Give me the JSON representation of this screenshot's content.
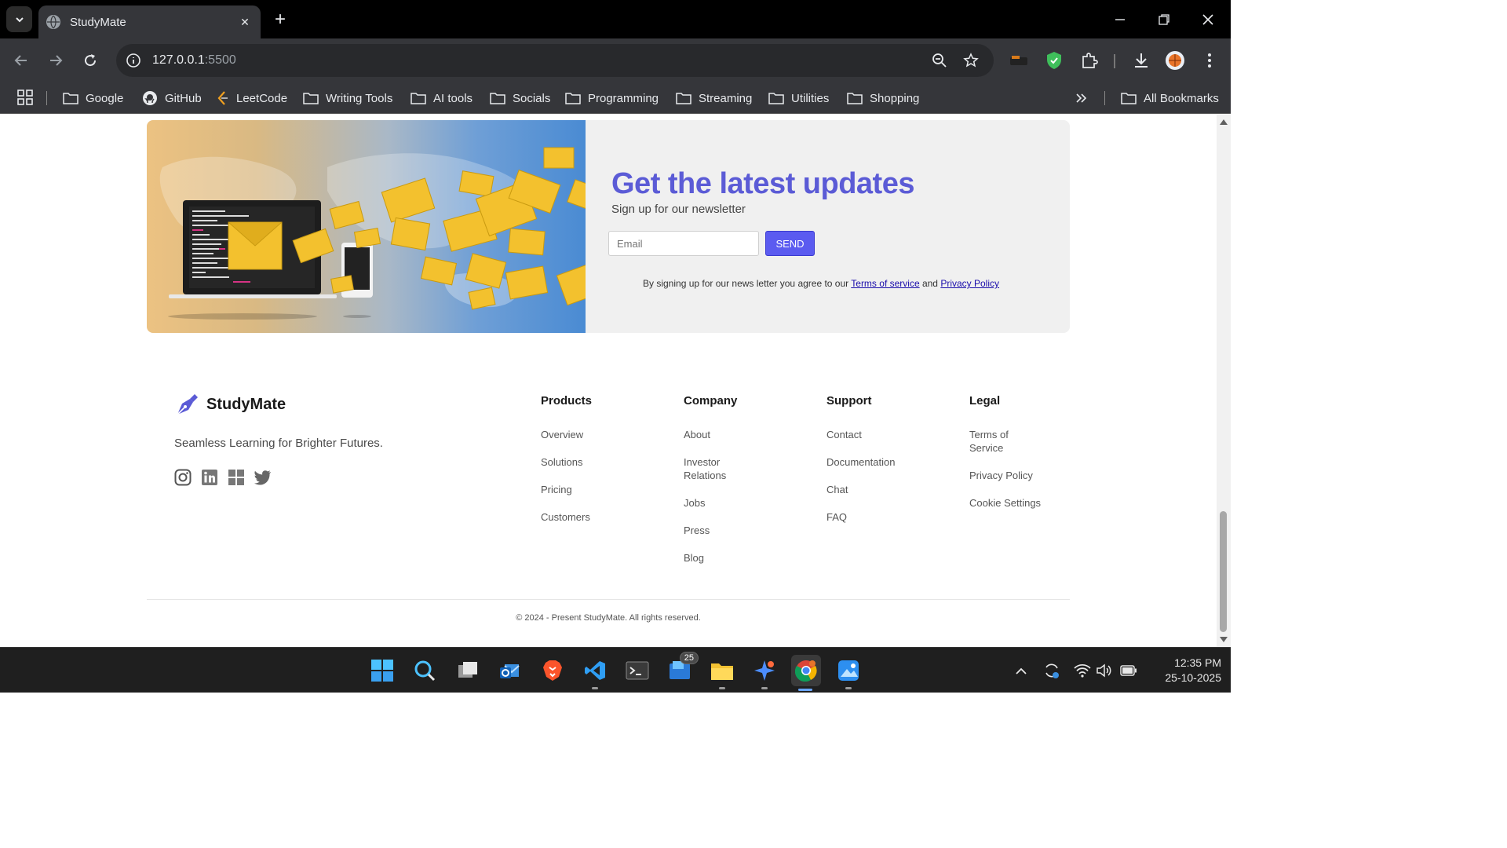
{
  "browser": {
    "tab_title": "StudyMate",
    "url_host": "127.0.0.1",
    "url_port": ":5500",
    "bookmarks": [
      "Google",
      "GitHub",
      "LeetCode",
      "Writing Tools",
      "AI tools",
      "Socials",
      "Programming",
      "Streaming",
      "Utilities",
      "Shopping"
    ],
    "all_bookmarks": "All Bookmarks"
  },
  "newsletter": {
    "heading": "Get the latest updates",
    "subheading": "Sign up for our newsletter",
    "email_placeholder": "Email",
    "send_label": "SEND",
    "legal_prefix": "By signing up for our news letter you agree to our ",
    "terms_link": "Terms of service",
    "legal_and": " and ",
    "privacy_link": "Privacy Policy"
  },
  "footer": {
    "brand": "StudyMate",
    "tagline": "Seamless Learning for Brighter Futures.",
    "columns": [
      {
        "title": "Products",
        "links": [
          "Overview",
          "Solutions",
          "Pricing",
          "Customers"
        ]
      },
      {
        "title": "Company",
        "links": [
          "About",
          "Investor Relations",
          "Jobs",
          "Press",
          "Blog"
        ]
      },
      {
        "title": "Support",
        "links": [
          "Contact",
          "Documentation",
          "Chat",
          "FAQ"
        ]
      },
      {
        "title": "Legal",
        "links": [
          "Terms of Service",
          "Privacy Policy",
          "Cookie Settings"
        ]
      }
    ],
    "copyright": "© 2024 - Present StudyMate. All rights reserved."
  },
  "taskbar": {
    "mail_badge": "25",
    "time": "12:35 PM",
    "date": "25-10-2025"
  },
  "colors": {
    "accent": "#5b5bd6",
    "send_button": "#5b5bf0"
  }
}
